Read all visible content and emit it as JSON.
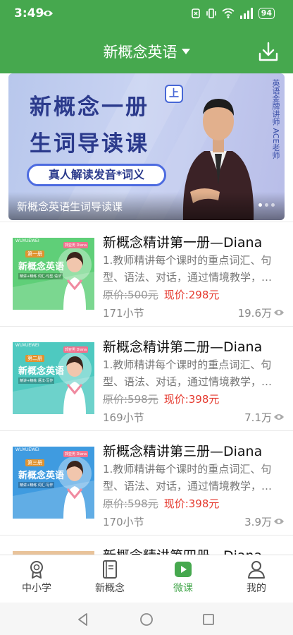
{
  "status": {
    "time": "3:49",
    "battery": "94"
  },
  "header": {
    "title": "新概念英语"
  },
  "banner": {
    "line1": "新概念一册",
    "line2": "生词导读课",
    "badge": "上",
    "pill": "真人解读发音*词义",
    "vertical": "英语金牌讲师 ACE老师",
    "caption": "新概念英语生词导读课"
  },
  "courses": [
    {
      "title": "新概念精讲第一册—Diana",
      "desc": "1.教师精讲每个课时的重点词汇、句型、语法、对话，通过情境教学，…",
      "orig_price": "原价:500元",
      "price": "现价:298元",
      "lessons": "171小节",
      "views": "19.6万",
      "thumb": {
        "brand": "WUXUEWEI",
        "book": "第一册",
        "title": "新概念英语",
        "sub": "精讲+精练 词汇·句型·语法",
        "bg": "#5fcf78",
        "name": "郭亚男 Diana"
      }
    },
    {
      "title": "新概念精讲第二册—Diana",
      "desc": "1.教师精讲每个课时的重点词汇、句型、语法、对话，通过情境教学，…",
      "orig_price": "原价:598元",
      "price": "现价:398元",
      "lessons": "169小节",
      "views": "7.1万",
      "thumb": {
        "brand": "WUXUEWEI",
        "book": "第二册",
        "title": "新概念英语",
        "sub": "精讲+精练 语法·写作",
        "bg": "#4ec9c0",
        "name": "郭亚男 Diana"
      }
    },
    {
      "title": "新概念精讲第三册—Diana",
      "desc": "1.教师精讲每个课时的重点词汇、句型、语法、对话，通过情境教学，…",
      "orig_price": "原价:598元",
      "price": "现价:398元",
      "lessons": "170小节",
      "views": "3.9万",
      "thumb": {
        "brand": "WUXUEWEI",
        "book": "第三册",
        "title": "新概念英语",
        "sub": "精讲+精练 词汇·写作",
        "bg": "#3f9be0",
        "name": "郭亚男 Diana"
      }
    },
    {
      "title": "新概念精讲第四册—Diana",
      "desc": "",
      "orig_price": "",
      "price": "",
      "lessons": "",
      "views": "",
      "thumb": {
        "brand": "",
        "book": "",
        "title": "",
        "sub": "",
        "bg": "#e9c39a",
        "name": ""
      }
    }
  ],
  "nav": [
    {
      "label": "中小学",
      "icon": "medal-icon",
      "active": false
    },
    {
      "label": "新概念",
      "icon": "book-icon",
      "active": false
    },
    {
      "label": "微课",
      "icon": "play-icon",
      "active": true
    },
    {
      "label": "我的",
      "icon": "profile-icon",
      "active": false
    }
  ],
  "colors": {
    "brand_green": "#46a84e",
    "price_red": "#e53a2f"
  }
}
